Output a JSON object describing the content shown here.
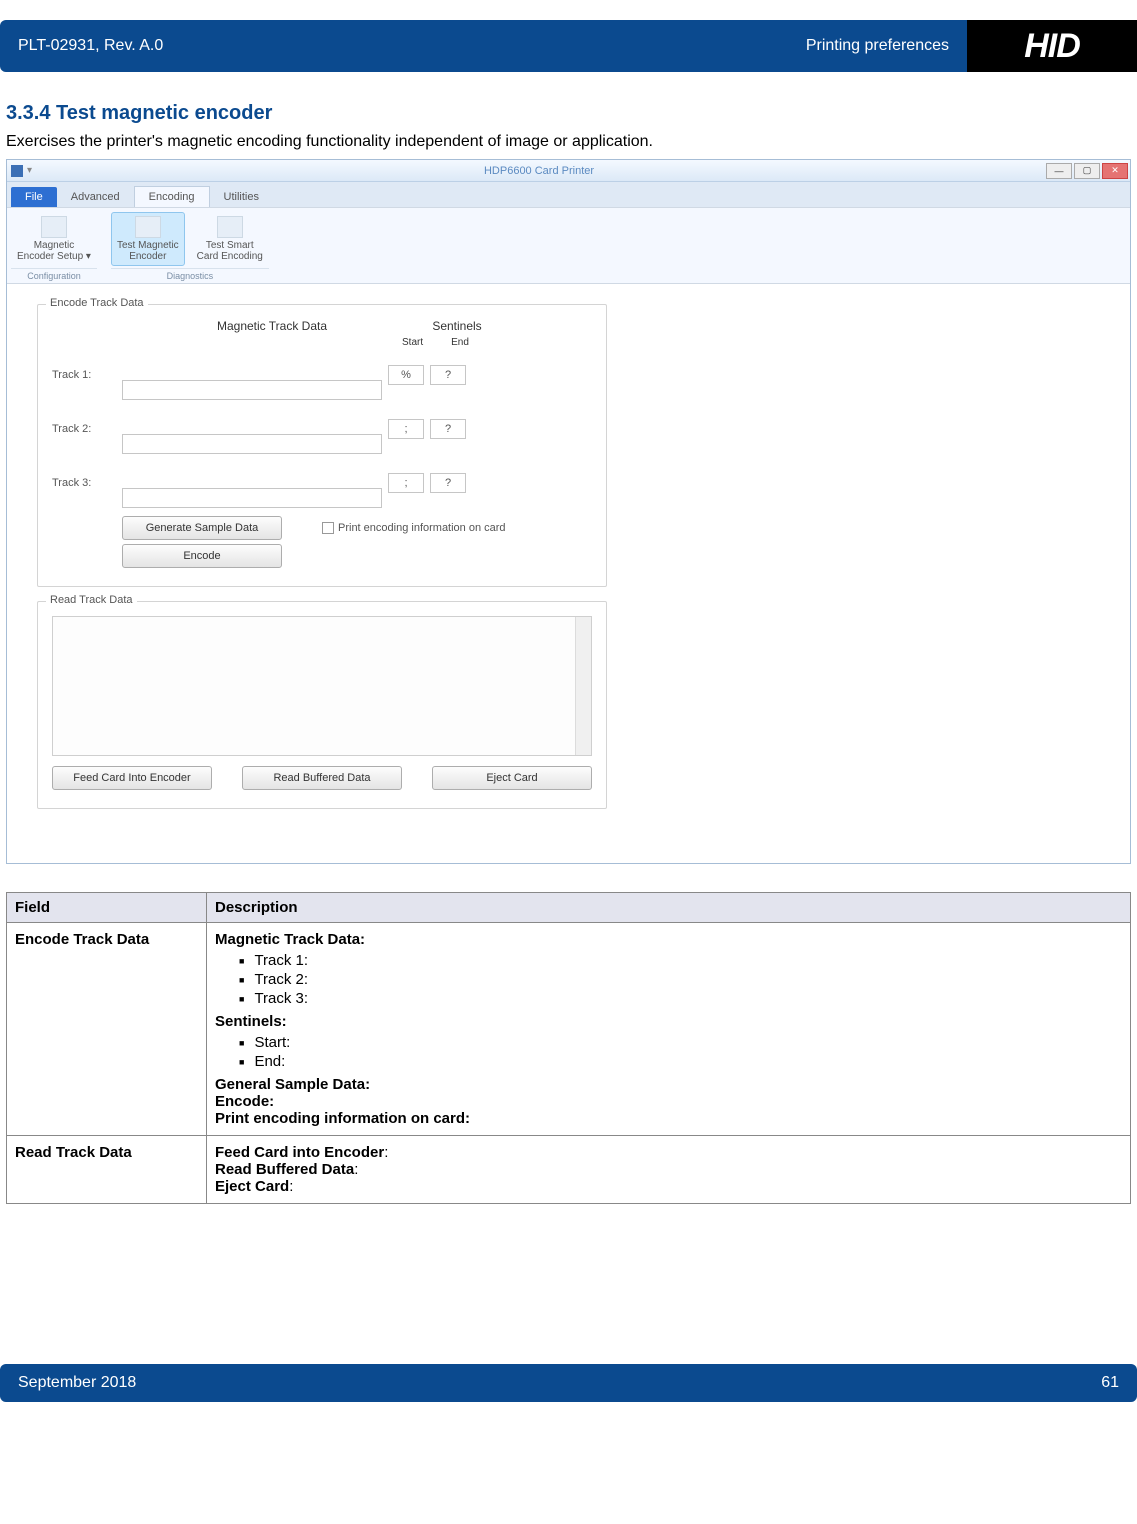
{
  "header": {
    "doc_id": "PLT-02931, Rev. A.0",
    "section": "Printing preferences",
    "logo_text": "HID",
    "reg": "®"
  },
  "section": {
    "number_title": "3.3.4 Test magnetic encoder",
    "intro": "Exercises the printer's magnetic encoding functionality independent of image or application."
  },
  "app": {
    "title": "HDP6600 Card Printer",
    "tabs": {
      "file": "File",
      "advanced": "Advanced",
      "encoding": "Encoding",
      "utilities": "Utilities"
    },
    "ribbon": {
      "group1": {
        "label": "Configuration",
        "item1": "Magnetic\nEncoder Setup ▾"
      },
      "group2": {
        "label": "Diagnostics",
        "item1": "Test Magnetic\nEncoder",
        "item2": "Test Smart\nCard Encoding"
      }
    },
    "encode": {
      "legend": "Encode Track Data",
      "mtd": "Magnetic Track Data",
      "sent": "Sentinels",
      "start": "Start",
      "end": "End",
      "t1": "Track 1:",
      "t2": "Track 2:",
      "t3": "Track 3:",
      "s1a": "%",
      "s1b": "?",
      "s2a": ";",
      "s2b": "?",
      "s3a": ";",
      "s3b": "?",
      "btn_gen": "Generate Sample Data",
      "btn_enc": "Encode",
      "cbx": "Print encoding information on card"
    },
    "read": {
      "legend": "Read Track Data",
      "btn_feed": "Feed Card Into Encoder",
      "btn_read": "Read Buffered Data",
      "btn_eject": "Eject Card"
    }
  },
  "table": {
    "h1": "Field",
    "h2": "Description",
    "r1f": "Encode Track Data",
    "r1": {
      "mtd": "Magnetic Track Data:",
      "t1": "Track 1:",
      "t2": "Track 2:",
      "t3": "Track 3:",
      "sent": "Sentinels:",
      "start": "Start:",
      "end": "End:",
      "gsd": "General Sample Data:",
      "enc": "Encode:",
      "print": "Print encoding information on card:"
    },
    "r2f": "Read Track Data",
    "r2": {
      "feed": "Feed Card into Encoder",
      "read": "Read Buffered Data",
      "eject": "Eject Card"
    }
  },
  "footer": {
    "date": "September 2018",
    "page": "61"
  }
}
